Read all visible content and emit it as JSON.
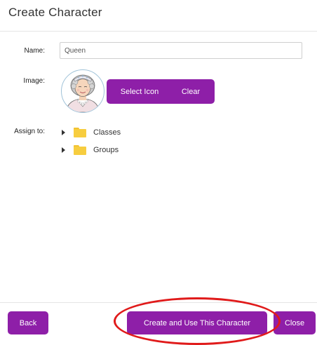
{
  "dialog": {
    "title": "Create Character"
  },
  "form": {
    "name_label": "Name:",
    "name_value": "Queen",
    "image_label": "Image:",
    "select_icon_label": "Select Icon",
    "clear_label": "Clear",
    "assign_label": "Assign to:",
    "tree": [
      {
        "label": "Classes",
        "icon": "folder-icon"
      },
      {
        "label": "Groups",
        "icon": "folder-icon"
      }
    ]
  },
  "footer": {
    "back_label": "Back",
    "create_label": "Create and Use This Character",
    "close_label": "Close"
  },
  "colors": {
    "accent": "#8e1fa8",
    "highlight": "#e01a1a",
    "folder": "#f7cd3f"
  },
  "icons": {
    "avatar": "queen-avatar-icon",
    "expander": "caret-right-icon",
    "folder": "folder-icon"
  }
}
